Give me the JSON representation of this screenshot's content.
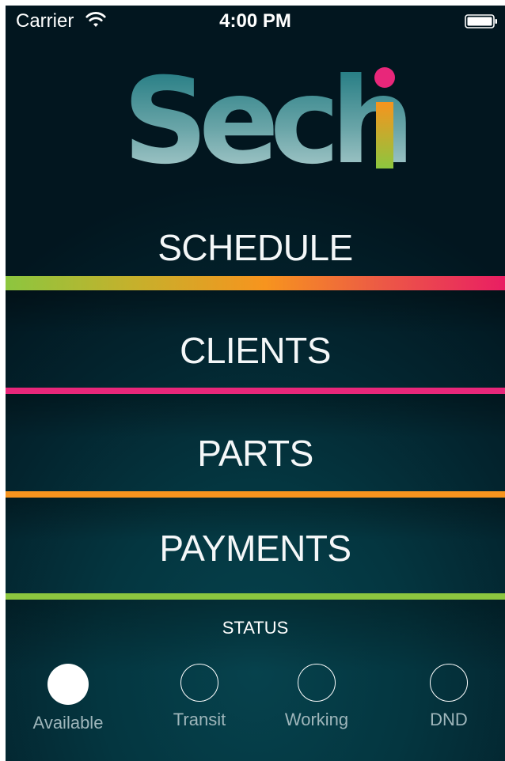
{
  "status_bar": {
    "carrier": "Carrier",
    "time": "4:00 PM",
    "icons": [
      "wifi-icon",
      "battery-icon"
    ]
  },
  "logo": {
    "text_main": "Sech",
    "text_accent": "i",
    "colors": {
      "main_top": "#14767a",
      "main_bottom": "#b7d2d2",
      "accent_dot": "#e8277a",
      "accent_top": "#f7941e",
      "accent_bottom": "#8cc63f"
    }
  },
  "menu": {
    "items": [
      {
        "label": "SCHEDULE"
      },
      {
        "label": "CLIENTS"
      },
      {
        "label": "PARTS"
      },
      {
        "label": "PAYMENTS"
      }
    ],
    "stripe_colors": [
      "#8cc63f",
      "#f7941e",
      "#e91e63",
      "#e8277a",
      "#f7941e",
      "#8cc63f"
    ]
  },
  "status": {
    "title": "STATUS",
    "options": [
      {
        "label": "Available",
        "selected": true
      },
      {
        "label": "Transit",
        "selected": false
      },
      {
        "label": "Working",
        "selected": false
      },
      {
        "label": "DND",
        "selected": false
      }
    ]
  },
  "colors": {
    "background_dark": "#02161f",
    "background_teal": "#06424d",
    "text": "#ffffff",
    "muted_text": "#9fb6bb"
  }
}
